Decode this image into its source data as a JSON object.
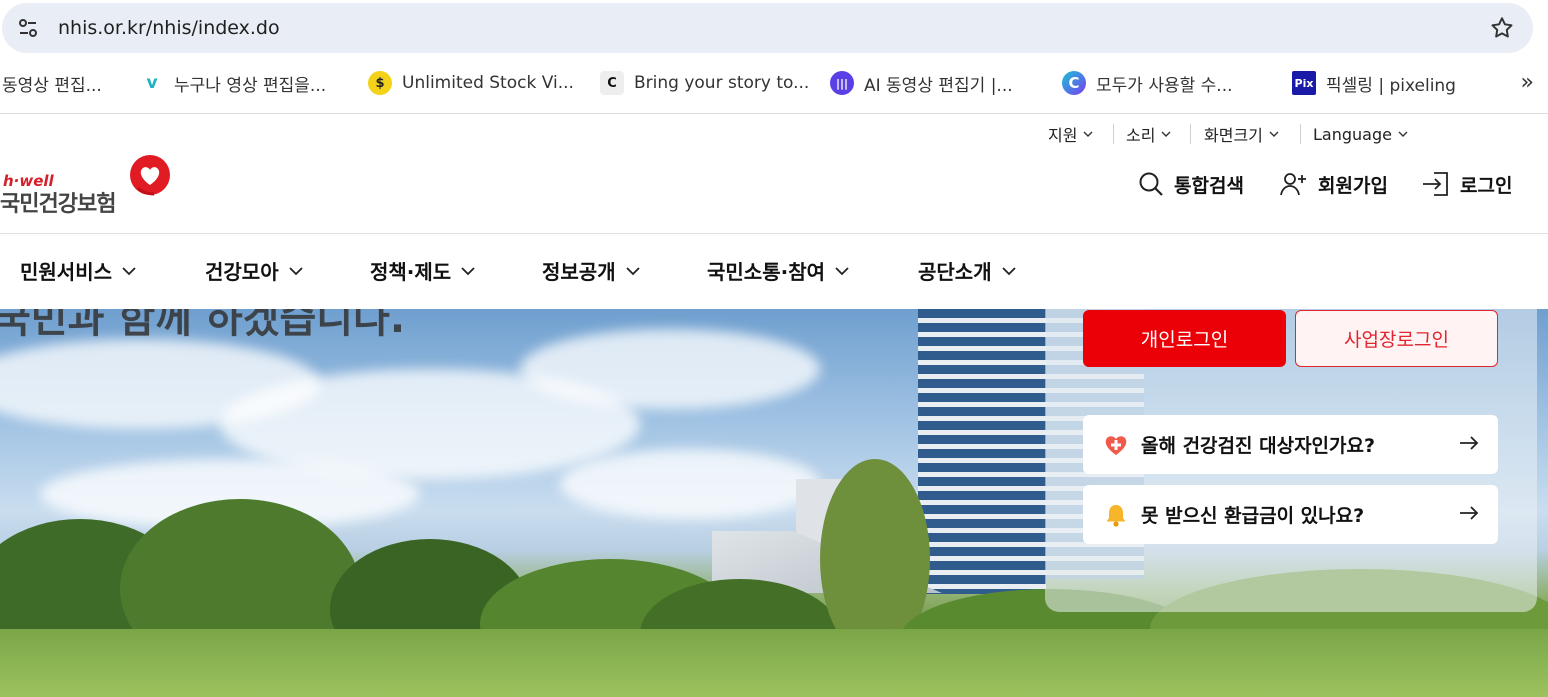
{
  "browser": {
    "url": "nhis.or.kr/nhis/index.do",
    "bookmarks": [
      {
        "label": "동영상 편집...",
        "icon": "none"
      },
      {
        "label": "누구나 영상 편집을...",
        "icon": "vrew-icon"
      },
      {
        "label": "Unlimited Stock Vi...",
        "icon": "storyblocks-icon"
      },
      {
        "label": "Bring your story to...",
        "icon": "clipchamp-icon"
      },
      {
        "label": "AI 동영상 편집기 |...",
        "icon": "audio-wave-icon"
      },
      {
        "label": "모두가 사용할 수...",
        "icon": "canva-icon"
      },
      {
        "label": "픽셀링 | pixeling",
        "icon": "pix-icon"
      }
    ],
    "more_label": "»"
  },
  "utility": {
    "support": "지원",
    "sound": "소리",
    "screen_size": "화면크기",
    "language": "Language"
  },
  "logo": {
    "brand": "h·well",
    "name": "국민건강보험"
  },
  "header_actions": {
    "search": "통합검색",
    "signup": "회원가입",
    "login": "로그인"
  },
  "nav": [
    {
      "label": "민원서비스"
    },
    {
      "label": "건강모아"
    },
    {
      "label": "정책·제도"
    },
    {
      "label": "정보공개"
    },
    {
      "label": "국민소통·참여"
    },
    {
      "label": "공단소개"
    }
  ],
  "hero": {
    "headline_partial": "국민과 함께 하겠습니다."
  },
  "login_panel": {
    "personal_login": "개인로그인",
    "business_login": "사업장로그인",
    "quick_links": [
      {
        "label": "올해 건강검진 대상자인가요?",
        "icon": "heart-plus-icon"
      },
      {
        "label": "못 받으신 환급금이 있나요?",
        "icon": "bell-icon"
      }
    ]
  },
  "colors": {
    "brand_red": "#eb0008",
    "omnibox_bg": "#e9eef6"
  }
}
